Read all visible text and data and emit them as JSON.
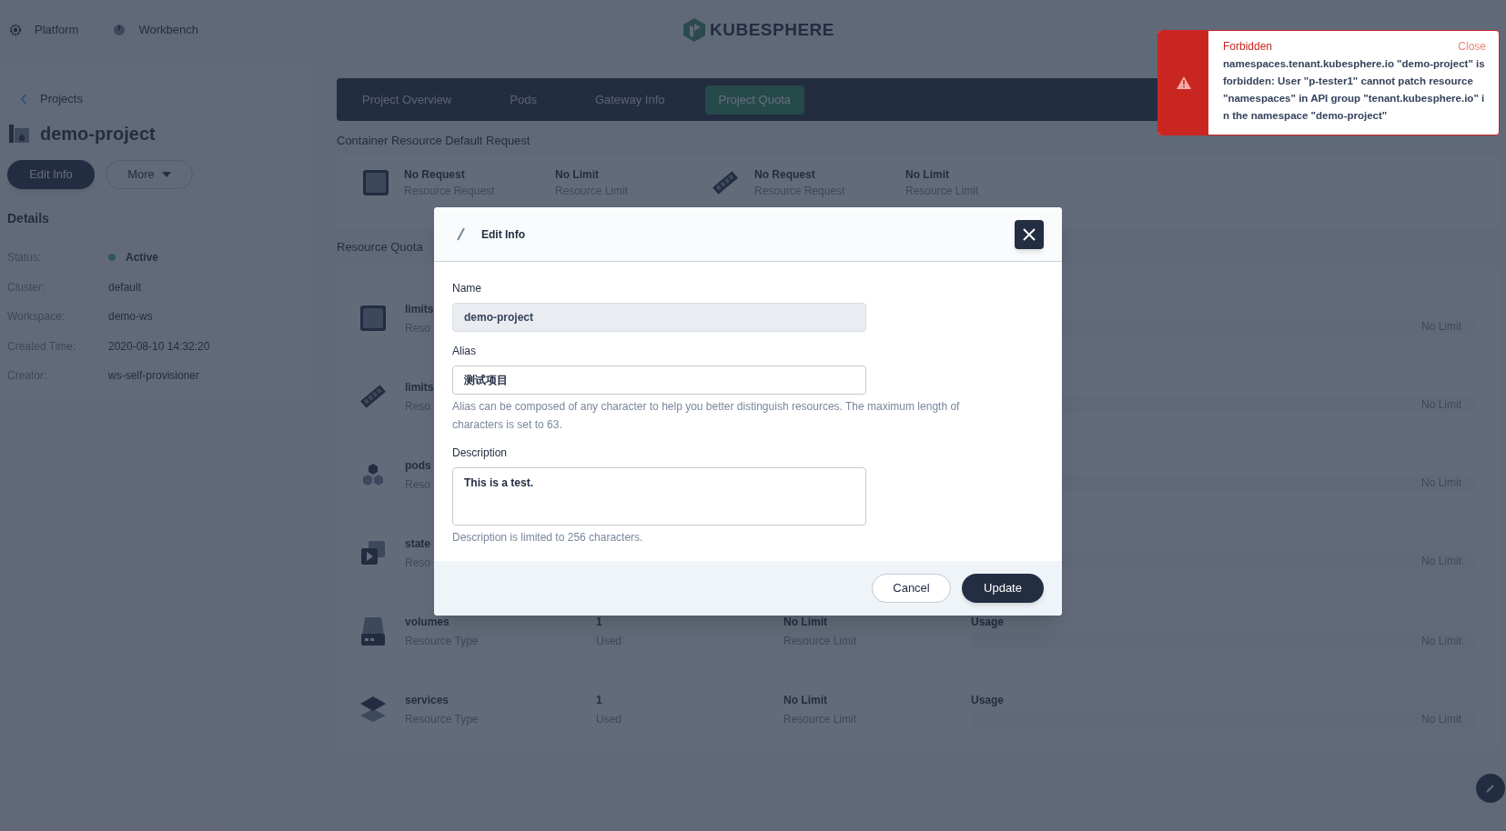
{
  "top_nav": [
    {
      "label": "Platform",
      "kind": "gear"
    },
    {
      "label": "Workbench",
      "kind": "dashboard"
    }
  ],
  "logo": {
    "text": "KUBESPHERE"
  },
  "sidebar": {
    "back_link": "Projects",
    "project_name": "demo-project",
    "buttons": [
      {
        "label": "Edit Info",
        "kind": "primary"
      },
      {
        "label": "More",
        "kind": "dropdown"
      }
    ],
    "details_title": "Details",
    "details": [
      {
        "label": "Status:",
        "value": "Active",
        "kind": "status"
      },
      {
        "label": "Cluster:",
        "value": "default",
        "kind": "text"
      },
      {
        "label": "Workspace:",
        "value": "demo-ws",
        "kind": "text"
      },
      {
        "label": "Created Time:",
        "value": "2020-08-10 14:32:20",
        "kind": "text"
      },
      {
        "label": "Creator:",
        "value": "ws-self-provisioner",
        "kind": "text"
      }
    ]
  },
  "tabs": [
    {
      "label": "Project Overview",
      "selected": false
    },
    {
      "label": "Pods",
      "selected": false
    },
    {
      "label": "Gateway Info",
      "selected": false
    },
    {
      "label": "Project Quota",
      "selected": true
    }
  ],
  "default_request": {
    "title": "Container Resource Default Request",
    "items": [
      {
        "kind": "cpu",
        "request": "No Request",
        "request_label": "Resource Request",
        "limit": "No Limit",
        "limit_label": "Resource Limit"
      },
      {
        "kind": "memory",
        "request": "No Request",
        "request_label": "Resource Request",
        "limit": "No Limit",
        "limit_label": "Resource Limit"
      }
    ]
  },
  "resource_quota": {
    "title": "Resource Quota",
    "rows": [
      {
        "kind": "cpu",
        "name": "limits",
        "type": "Reso",
        "usage_text": "No Limit"
      },
      {
        "kind": "memory",
        "name": "limits",
        "type": "Reso",
        "usage_text": "No Limit"
      },
      {
        "kind": "pods",
        "name": "pods",
        "type": "Reso",
        "usage_text": "No Limit"
      },
      {
        "kind": "statefulset",
        "name": "state",
        "type": "Reso",
        "usage_text": "No Limit"
      },
      {
        "kind": "volume",
        "name": "volumes",
        "type": "Resource Type",
        "used": "1",
        "used_label": "Used",
        "limit": "No Limit",
        "limit_label": "Resource Limit",
        "usage": "Usage",
        "usage_text": "No Limit"
      },
      {
        "kind": "service",
        "name": "services",
        "type": "Resource Type",
        "used": "1",
        "used_label": "Used",
        "limit": "No Limit",
        "limit_label": "Resource Limit",
        "usage": "Usage",
        "usage_text": "No Limit"
      }
    ]
  },
  "modal": {
    "title": "Edit Info",
    "fields": [
      {
        "label": "Name",
        "value": "demo-project",
        "kind": "input",
        "disabled": true
      },
      {
        "label": "Alias",
        "value": "测试项目",
        "kind": "input",
        "disabled": false,
        "hint": "Alias can be composed of any character to help you better distinguish resources. The maximum length of characters is set to 63."
      },
      {
        "label": "Description",
        "value": "This is a test.",
        "kind": "textarea",
        "disabled": false,
        "hint": "Description is limited to 256 characters."
      }
    ],
    "buttons": [
      {
        "label": "Cancel",
        "kind": "secondary"
      },
      {
        "label": "Update",
        "kind": "primary"
      }
    ]
  },
  "notification": {
    "title": "Forbidden",
    "close": "Close",
    "message": "namespaces.tenant.kubesphere.io \"demo-project\" is forbidden: User \"p-tester1\" cannot patch resource \"namespaces\" in API group \"tenant.kubesphere.io\" in the namespace \"demo-project\""
  }
}
